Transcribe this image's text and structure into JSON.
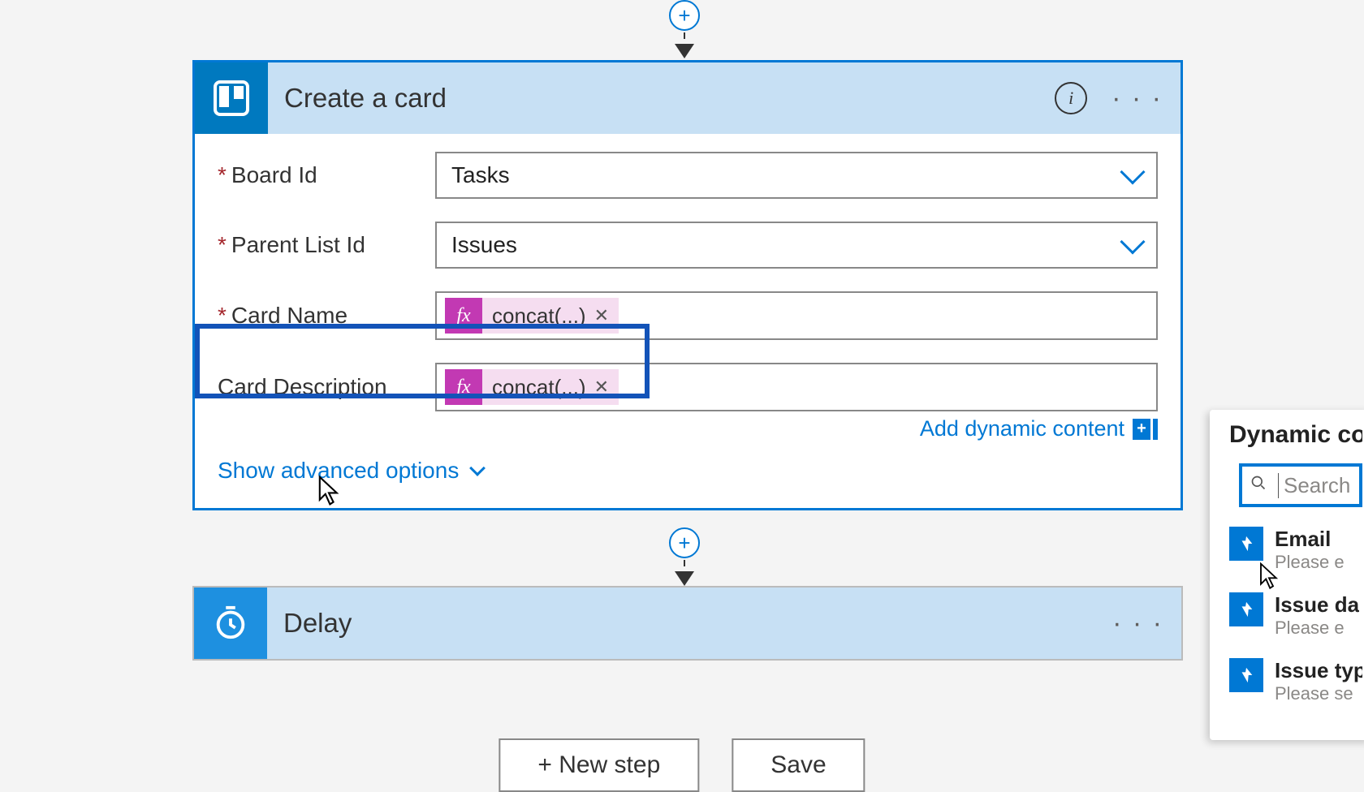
{
  "connector1": {
    "plus": "+"
  },
  "card": {
    "title": "Create a card",
    "info": "i",
    "more": "· · ·",
    "rows": {
      "boardId": {
        "label": "Board Id",
        "value": "Tasks",
        "required": true
      },
      "parentList": {
        "label": "Parent List Id",
        "value": "Issues",
        "required": true
      },
      "cardName": {
        "label": "Card Name",
        "token": "concat(...)",
        "fx": "fx",
        "required": true
      },
      "cardDesc": {
        "label": "Card Description",
        "token": "concat(...)",
        "fx": "fx",
        "required": false
      }
    },
    "addDynamic": "Add dynamic content",
    "showAdvanced": "Show advanced options"
  },
  "connector2": {
    "plus": "+"
  },
  "delay": {
    "title": "Delay",
    "more": "· · ·"
  },
  "buttons": {
    "newStep": "+  New step",
    "save": "Save"
  },
  "dynPanel": {
    "tab": "Dynamic con",
    "searchPlaceholder": "Search",
    "items": [
      {
        "name": "Email",
        "desc": "Please e"
      },
      {
        "name": "Issue da",
        "desc": "Please e"
      },
      {
        "name": "Issue typ",
        "desc": "Please se"
      }
    ]
  }
}
